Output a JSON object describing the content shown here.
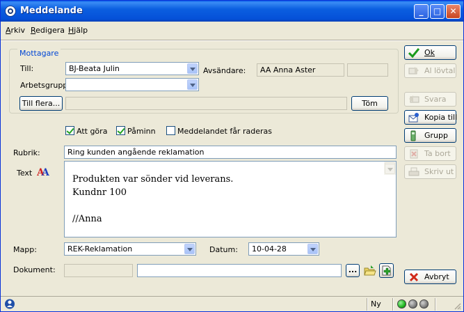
{
  "window": {
    "title": "Meddelande"
  },
  "menu": [
    {
      "label": "Arkiv",
      "key": "A"
    },
    {
      "label": "Redigera",
      "key": "R"
    },
    {
      "label": "Hjälp",
      "key": "H"
    }
  ],
  "recipients": {
    "group_title": "Mottagare",
    "till_label": "Till:",
    "till_value": "BJ-Beata Julin",
    "sender_label": "Avsändare:",
    "sender_value": "AA Anna Aster",
    "sender_extra": "",
    "workgroup_label": "Arbetsgrupp:",
    "workgroup_value": "",
    "more_button": "Till flera...",
    "more_field": "",
    "clear_button": "Töm"
  },
  "options": {
    "todo": {
      "label": "Att göra",
      "checked": true
    },
    "reminder": {
      "label": "Påminn",
      "checked": true
    },
    "deletable": {
      "label": "Meddelandet får raderas",
      "checked": false
    }
  },
  "subject": {
    "label": "Rubrik:",
    "value": "Ring kunden angående reklamation"
  },
  "body": {
    "label": "Text",
    "lines": [
      "Produkten var sönder vid leverans.",
      "Kundnr 100",
      "",
      "//Anna"
    ]
  },
  "folder": {
    "label": "Mapp:",
    "value": "REK-Reklamation"
  },
  "date": {
    "label": "Datum:",
    "value": "10-04-28"
  },
  "document": {
    "label": "Dokument:",
    "value1": "",
    "value2": "",
    "browse_label": "..."
  },
  "side_buttons": {
    "ok": "Ok",
    "forward": "Al lövtal",
    "reply": "Svara",
    "copy_to": "Kopia till",
    "group": "Grupp",
    "remove": "Ta bort",
    "print": "Skriv ut",
    "cancel": "Avbryt"
  },
  "status": {
    "mode": "Ny"
  },
  "colors": {
    "accent": "#0a5ee8",
    "led_green": "#1fb51f",
    "led_gray": "#808080"
  }
}
